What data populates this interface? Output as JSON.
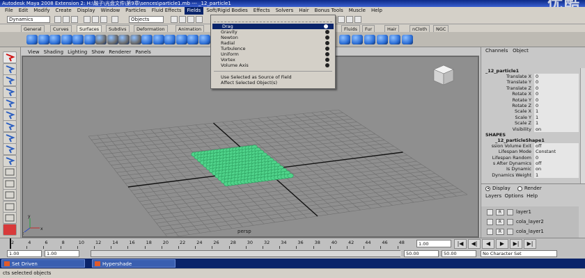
{
  "window": {
    "title": "Autodesk Maya 2008 Extension 2: H:\\鞍子\\光盘文件\\第9章\\sences\\particle1.mb  ---  _12_particle1",
    "watermark": "优酷"
  },
  "menubar": [
    "File",
    "Edit",
    "Modify",
    "Create",
    "Display",
    "Window",
    "Particles",
    "Fluid Effects",
    "Fields",
    "Soft/Rigid Bodies",
    "Effects",
    "Solvers",
    "Hair",
    "Bonus Tools",
    "Muscle",
    "Help"
  ],
  "menubar_active": "Fields",
  "status_line": {
    "mode": "Dynamics",
    "selection_mode": "Objects"
  },
  "shelf_tabs": [
    "General",
    "Curves",
    "Surfaces",
    "Subdivs",
    "Deformation",
    "Animation",
    "Fluids",
    "Fur",
    "Hair",
    "nCloth",
    "NGC"
  ],
  "shelf_active": "Surfaces",
  "fields_menu": {
    "items": [
      "Drag",
      "Gravity",
      "Newton",
      "Radial",
      "Turbulence",
      "Uniform",
      "Vortex",
      "Volume Axis"
    ],
    "highlighted": "Drag",
    "extra": [
      "Use Selected as Source of Field",
      "Affect Selected Object(s)"
    ]
  },
  "viewport": {
    "menu": [
      "View",
      "Shading",
      "Lighting",
      "Show",
      "Renderer",
      "Panels"
    ],
    "label": "persp",
    "axis": [
      "x",
      "y",
      "z"
    ]
  },
  "channel_box": {
    "header": [
      "Channels",
      "Object"
    ],
    "object": "_12_particle1",
    "attributes": [
      {
        "k": "Translate X",
        "v": "0"
      },
      {
        "k": "Translate Y",
        "v": "0"
      },
      {
        "k": "Translate Z",
        "v": "0"
      },
      {
        "k": "Rotate X",
        "v": "0"
      },
      {
        "k": "Rotate Y",
        "v": "0"
      },
      {
        "k": "Rotate Z",
        "v": "0"
      },
      {
        "k": "Scale X",
        "v": "1"
      },
      {
        "k": "Scale Y",
        "v": "1"
      },
      {
        "k": "Scale Z",
        "v": "1"
      },
      {
        "k": "Visibility",
        "v": "on"
      }
    ],
    "shapes_label": "SHAPES",
    "shape_name": "_12_particleShape1",
    "shape_attributes": [
      {
        "k": "ssion Volume Exit",
        "v": "off"
      },
      {
        "k": "Lifespan Mode",
        "v": "Constant"
      },
      {
        "k": "Lifespan Random",
        "v": "0"
      },
      {
        "k": "s After Dynamics",
        "v": "off"
      },
      {
        "k": "Is Dynamic",
        "v": "on"
      },
      {
        "k": "Dynamics Weight",
        "v": "1"
      }
    ]
  },
  "layer_editor": {
    "radio": [
      "Display",
      "Render"
    ],
    "radio_selected": "Display",
    "menu": [
      "Layers",
      "Options",
      "Help"
    ],
    "layers": [
      "layer1",
      "cola_layer2",
      "cola_layer1"
    ],
    "layer_flag": "R"
  },
  "time_slider": {
    "ticks": [
      "2",
      "4",
      "6",
      "8",
      "10",
      "12",
      "14",
      "16",
      "18",
      "20",
      "22",
      "24",
      "26",
      "28",
      "30",
      "32",
      "34",
      "36",
      "38",
      "40",
      "42",
      "44",
      "46",
      "48"
    ],
    "current": "1.00",
    "play_controls": [
      "|◀",
      "◀|",
      "◀",
      "▶",
      "▶|",
      "▶|"
    ]
  },
  "range_slider": {
    "start": "1.00",
    "min": "1.00",
    "end": "50.00",
    "max": "50.00",
    "character_set": "No Character Set"
  },
  "taskbar": [
    "Set Driven",
    "Hypershade"
  ],
  "help_line": "cts selected objects"
}
